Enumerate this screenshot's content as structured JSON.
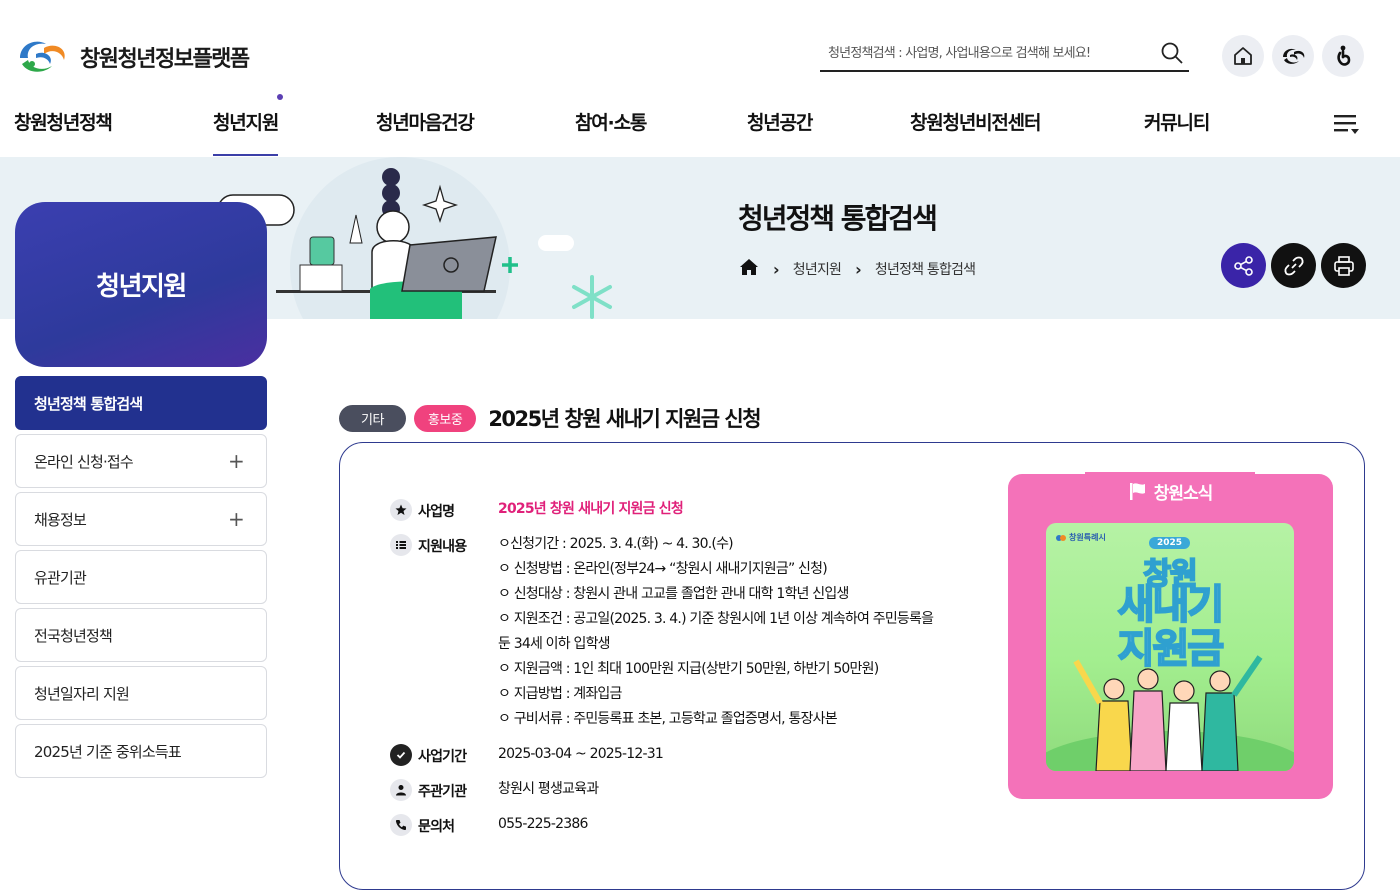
{
  "header": {
    "site_name": "창원청년정보플랫폼",
    "search_placeholder": "청년정책검색 : 사업명, 사업내용으로 검색해 보세요!",
    "top_icons": [
      "home-icon",
      "changwon-city-icon",
      "accessibility-icon"
    ]
  },
  "gnb": {
    "items": [
      "창원청년정책",
      "청년지원",
      "청년마음건강",
      "참여·소통",
      "청년공간",
      "창원청년비전센터",
      "커뮤니티"
    ],
    "active": "청년지원"
  },
  "banner": {
    "title": "청년정책 통합검색",
    "breadcrumb": [
      "청년지원",
      "청년정책 통합검색"
    ]
  },
  "sidebar": {
    "title": "청년지원",
    "items": [
      {
        "label": "청년정책 통합검색",
        "active": true,
        "expandable": false
      },
      {
        "label": "온라인 신청·접수",
        "active": false,
        "expandable": true
      },
      {
        "label": "채용정보",
        "active": false,
        "expandable": true
      },
      {
        "label": "유관기관",
        "active": false,
        "expandable": false
      },
      {
        "label": "전국청년정책",
        "active": false,
        "expandable": false
      },
      {
        "label": "청년일자리 지원",
        "active": false,
        "expandable": false
      },
      {
        "label": "2025년 기준 중위소득표",
        "active": false,
        "expandable": false
      }
    ]
  },
  "post": {
    "category_tag": "기타",
    "status_tag": "홍보중",
    "title": "2025년 창원 새내기 지원금 신청",
    "name_label": "사업명",
    "name_value": "2025년 창원 새내기 지원금 신청",
    "content_label": "지원내용",
    "content_lines": [
      "ㅇ신청기간 : 2025. 3. 4.(화) ~ 4. 30.(수)",
      "ㅇ 신청방법 : 온라인(정부24→ “창원시 새내기지원금” 신청)",
      "ㅇ 신청대상 : 창원시 관내 고교를 졸업한 관내 대학 1학년 신입생",
      "ㅇ 지원조건 : 공고일(2025. 3. 4.) 기준 창원시에 1년 이상 계속하여 주민등록을",
      "둔 34세 이하 입학생",
      "ㅇ 지원금액 : 1인 최대 100만원 지급(상반기 50만원, 하반기 50만원)",
      "ㅇ 지급방법 : 계좌입금",
      "ㅇ 구비서류 : 주민등록표 초본, 고등학교 졸업증명서, 통장사본"
    ],
    "period_label": "사업기간",
    "period_value": "2025-03-04 ~ 2025-12-31",
    "org_label": "주관기관",
    "org_value": "창원시 평생교육과",
    "contact_label": "문의처",
    "contact_value": "055-225-2386"
  },
  "promo": {
    "badge": "창원소식",
    "city": "창원특례시",
    "year": "2025",
    "title_line1": "창원",
    "title_line2": "새내기",
    "title_line3": "지원금"
  },
  "colors": {
    "primary": "#22318f",
    "accent_pink": "#f0427e",
    "promo_pink": "#f472b9",
    "banner_bg": "#e9f1f5"
  }
}
